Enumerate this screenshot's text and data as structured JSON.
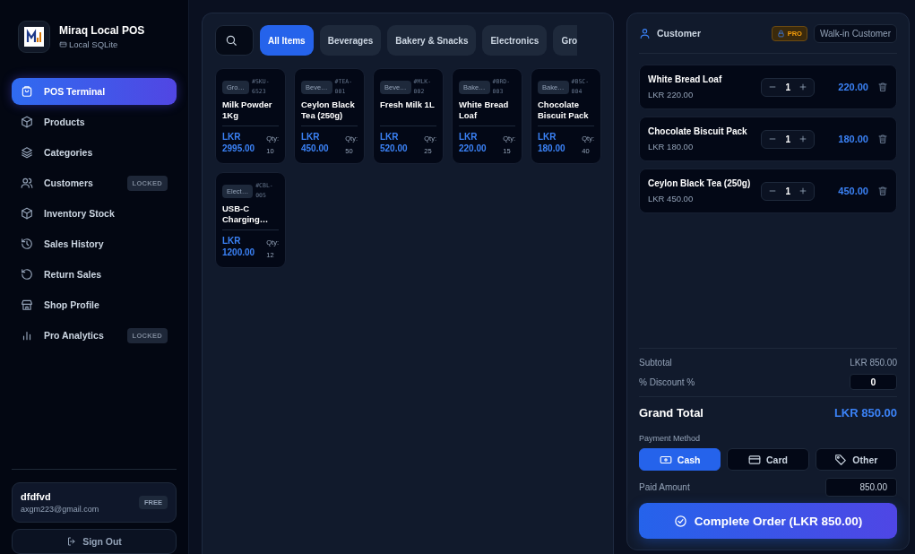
{
  "app": {
    "name": "Miraq Local POS",
    "storage": "Local SQLite"
  },
  "nav": [
    {
      "label": "POS Terminal",
      "kind": "bag",
      "selected": true
    },
    {
      "label": "Products",
      "kind": "box",
      "selected": false
    },
    {
      "label": "Categories",
      "kind": "layers",
      "selected": false
    },
    {
      "label": "Customers",
      "kind": "users",
      "selected": false,
      "badge": "LOCKED"
    },
    {
      "label": "Inventory Stock",
      "kind": "box",
      "selected": false
    },
    {
      "label": "Sales History",
      "kind": "history",
      "selected": false
    },
    {
      "label": "Return Sales",
      "kind": "undo",
      "selected": false
    },
    {
      "label": "Shop Profile",
      "kind": "store",
      "selected": false
    },
    {
      "label": "Pro Analytics",
      "kind": "chart",
      "selected": false,
      "badge": "LOCKED"
    }
  ],
  "user": {
    "name": "dfdfvd",
    "email": "axgm223@gmail.com",
    "plan": "FREE"
  },
  "sign_out": "Sign Out",
  "categories": [
    {
      "label": "All Items",
      "selected": true
    },
    {
      "label": "Beverages",
      "selected": false
    },
    {
      "label": "Bakery & Snacks",
      "selected": false
    },
    {
      "label": "Electronics",
      "selected": false
    },
    {
      "label": "Gro",
      "selected": false
    }
  ],
  "products": [
    {
      "category": "Gro…",
      "sku": "#SKU-6523",
      "name": "Milk Powder 1Kg",
      "currency": "LKR",
      "price": "2995.00",
      "qty_label": "Qty:",
      "qty": "10"
    },
    {
      "category": "Beve…",
      "sku": "#TEA-001",
      "name": "Ceylon Black Tea (250g)",
      "currency": "LKR",
      "price": "450.00",
      "qty_label": "Qty:",
      "qty": "50"
    },
    {
      "category": "Beve…",
      "sku": "#MLK-002",
      "name": "Fresh Milk 1L",
      "currency": "LKR",
      "price": "520.00",
      "qty_label": "Qty:",
      "qty": "25"
    },
    {
      "category": "Bake…",
      "sku": "#BRD-003",
      "name": "White Bread Loaf",
      "currency": "LKR",
      "price": "220.00",
      "qty_label": "Qty:",
      "qty": "15"
    },
    {
      "category": "Bake…",
      "sku": "#BSC-004",
      "name": "Chocolate Biscuit Pack",
      "currency": "LKR",
      "price": "180.00",
      "qty_label": "Qty:",
      "qty": "40"
    },
    {
      "category": "Elect…",
      "sku": "#CBL-005",
      "name": "USB-C Charging…",
      "currency": "LKR",
      "price": "1200.00",
      "qty_label": "Qty:",
      "qty": "12"
    }
  ],
  "customer": {
    "label": "Customer",
    "pro_badge": "PRO",
    "value": "Walk-in Customer"
  },
  "cart": [
    {
      "name": "White Bread Loaf",
      "unit_price": "LKR 220.00",
      "qty": "1",
      "total": "220.00"
    },
    {
      "name": "Chocolate Biscuit Pack",
      "unit_price": "LKR 180.00",
      "qty": "1",
      "total": "180.00"
    },
    {
      "name": "Ceylon Black Tea (250g)",
      "unit_price": "LKR 450.00",
      "qty": "1",
      "total": "450.00"
    }
  ],
  "summary": {
    "subtotal_label": "Subtotal",
    "subtotal": "LKR 850.00",
    "discount_label": "% Discount %",
    "discount": "0",
    "grand_total_label": "Grand Total",
    "grand_total": "LKR 850.00"
  },
  "payment": {
    "label": "Payment Method",
    "methods": [
      {
        "label": "Cash",
        "kind": "cash",
        "selected": true
      },
      {
        "label": "Card",
        "kind": "card",
        "selected": false
      },
      {
        "label": "Other",
        "kind": "tag",
        "selected": false
      }
    ],
    "paid_label": "Paid Amount",
    "paid": "850.00"
  },
  "complete_button": "Complete Order (LKR 850.00)"
}
